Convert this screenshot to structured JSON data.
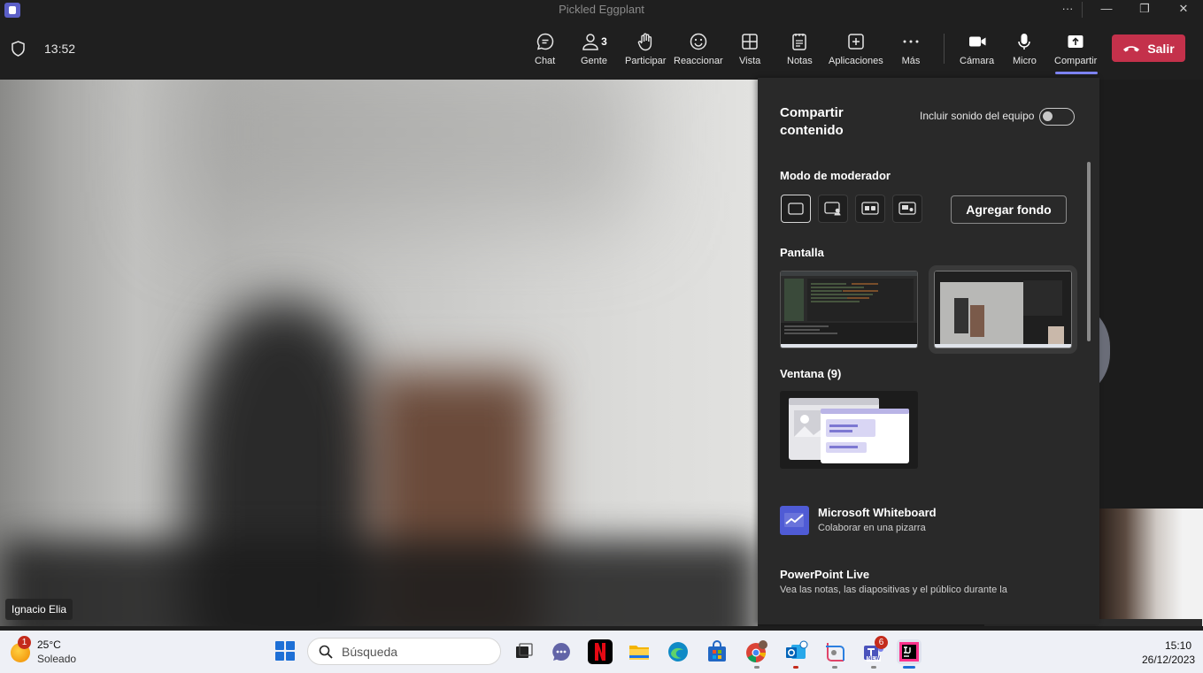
{
  "window": {
    "title": "Pickled Eggplant",
    "more": "···",
    "minimize": "—",
    "restore": "❐",
    "close": "✕"
  },
  "toolbar": {
    "time": "13:52",
    "people_count": "3",
    "buttons": [
      {
        "label": "Chat",
        "icon": "chat-icon"
      },
      {
        "label": "Gente",
        "icon": "people-icon"
      },
      {
        "label": "Participar",
        "icon": "raise-hand-icon"
      },
      {
        "label": "Reaccionar",
        "icon": "react-icon"
      },
      {
        "label": "Vista",
        "icon": "view-icon"
      },
      {
        "label": "Notas",
        "icon": "notes-icon"
      },
      {
        "label": "Aplicaciones",
        "icon": "apps-icon"
      },
      {
        "label": "Más",
        "icon": "more-icon"
      },
      {
        "label": "Cámara",
        "icon": "camera-icon"
      },
      {
        "label": "Micro",
        "icon": "mic-icon"
      },
      {
        "label": "Compartir",
        "icon": "share-icon"
      }
    ],
    "leave_label": "Salir"
  },
  "stage": {
    "participant_name": "Ignacio Elia"
  },
  "share_panel": {
    "title": "Compartir contenido",
    "include_sound": "Incluir sonido del equipo",
    "include_sound_on": false,
    "presenter_mode": "Modo de moderador",
    "add_background": "Agregar fondo",
    "screen": "Pantalla",
    "window": "Ventana (9)",
    "apps": [
      {
        "name": "Microsoft Whiteboard",
        "desc": "Colaborar en una pizarra"
      },
      {
        "name": "PowerPoint Live",
        "desc": "Vea las notas, las diapositivas y el público durante la"
      }
    ]
  },
  "taskbar": {
    "weather_badge": "1",
    "temperature": "25°C",
    "condition": "Soleado",
    "search_placeholder": "Búsqueda",
    "teams_badge": "6",
    "teams_new": "NEW",
    "time": "15:10",
    "date": "26/12/2023"
  },
  "colors": {
    "accent": "#7f85f5",
    "leave": "#c4314b",
    "whiteboard": "#4f5bd5"
  }
}
